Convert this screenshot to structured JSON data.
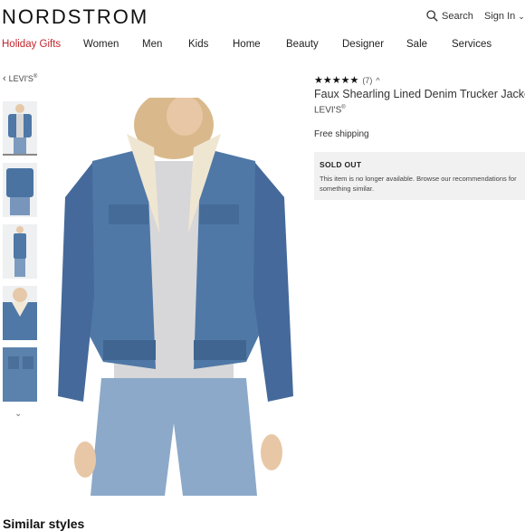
{
  "header": {
    "logo": "NORDSTROM",
    "search_label": "Search",
    "signin_label": "Sign In"
  },
  "nav": {
    "items": [
      "Holiday Gifts",
      "Women",
      "Men",
      "Kids",
      "Home",
      "Beauty",
      "Designer",
      "Sale",
      "Services"
    ]
  },
  "breadcrumb": {
    "label": "LEVI'S",
    "reg": "®"
  },
  "product": {
    "rating_stars": "★★★★★",
    "rating_value": 4.5,
    "review_count": "(7)",
    "title": "Faux Shearling Lined Denim Trucker Jacket",
    "brand": "LEVI'S",
    "brand_reg": "®",
    "shipping": "Free shipping",
    "status_title": "SOLD OUT",
    "status_message": "This item is no longer available. Browse our recommendations for something similar."
  },
  "similar_heading": "Similar styles",
  "colors": {
    "holiday": "#c2262e",
    "denim": "#4f78a6",
    "soldout_bg": "#f1f1f1"
  },
  "icons": [
    "search-icon",
    "chevron-down-icon",
    "chevron-left-icon",
    "chevron-up-icon"
  ]
}
